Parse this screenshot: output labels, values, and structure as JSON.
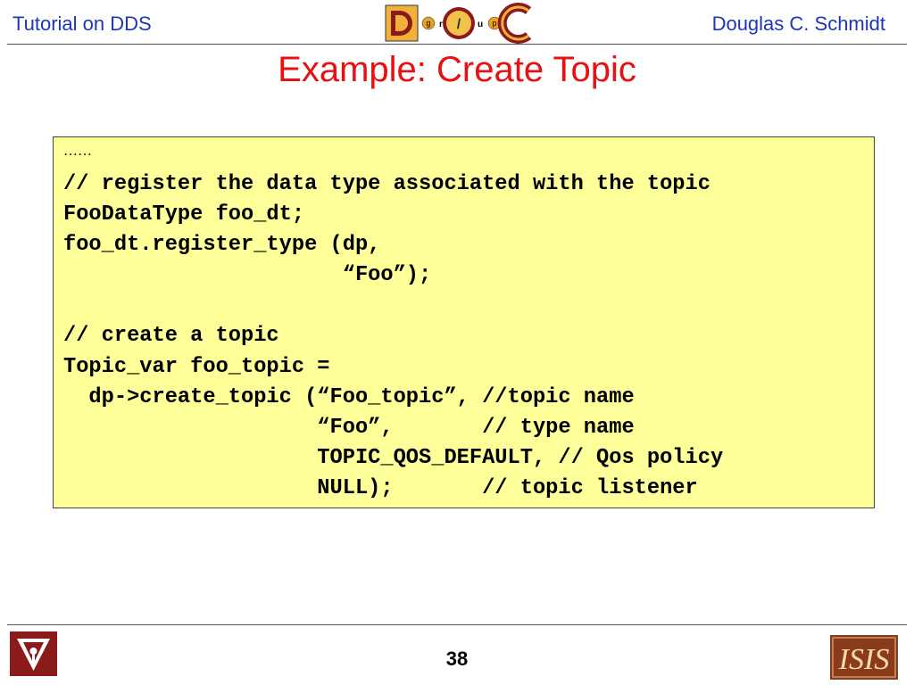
{
  "header": {
    "left": "Tutorial on DDS",
    "right": "Douglas C. Schmidt",
    "logo_letters": [
      "D",
      "g",
      "r",
      "/",
      "u",
      "p",
      "C"
    ]
  },
  "title": "Example: Create Topic",
  "code_box": {
    "ellipsis": "……",
    "code": "// register the data type associated with the topic\nFooDataType foo_dt;\nfoo_dt.register_type (dp,\n                      “Foo”);\n\n// create a topic\nTopic_var foo_topic =\n  dp->create_topic (“Foo_topic”, //topic name\n                    “Foo”,       // type name\n                    TOPIC_QOS_DEFAULT, // Qos policy\n                    NULL);       // topic listener"
  },
  "footer": {
    "page_number": "38",
    "left_logo": "vanderbilt-logo",
    "right_logo": "isis-logo",
    "right_logo_text": "ISIS"
  },
  "colors": {
    "header_text": "#1f35b8",
    "title_text": "#e81010",
    "code_background": "#ffff99",
    "logo_maroon": "#8b1a1a",
    "logo_gold": "#e8a020"
  }
}
